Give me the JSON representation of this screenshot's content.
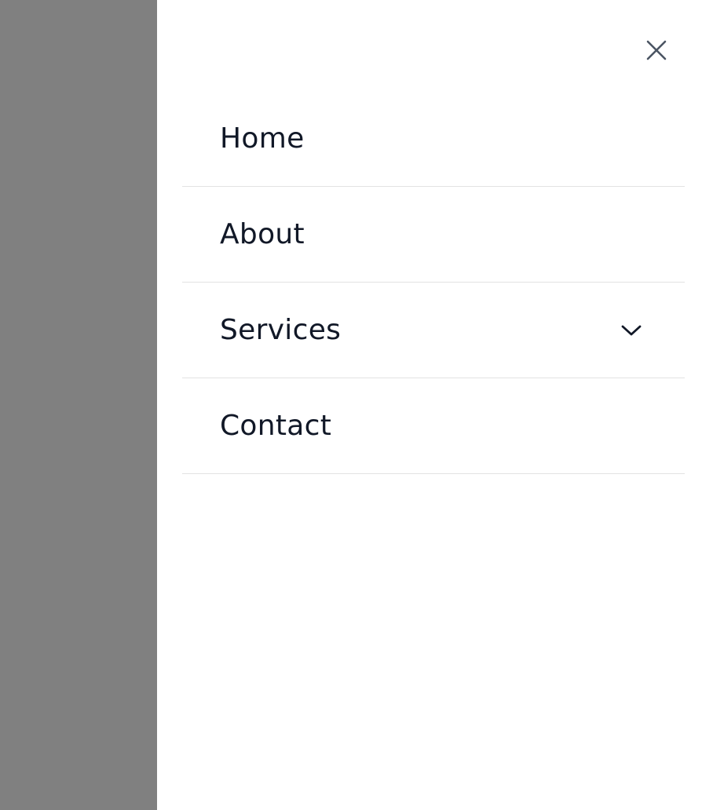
{
  "colors": {
    "overlay": "#808080",
    "drawer_bg": "#ffffff",
    "text": "#111827",
    "divider": "#e2e2e2",
    "icon": "#4b5563"
  },
  "drawer": {
    "close_icon": "close-icon",
    "nav": {
      "items": [
        {
          "label": "Home"
        },
        {
          "label": "About"
        },
        {
          "label": "Services",
          "icon": "chevron-down-icon"
        },
        {
          "label": "Contact"
        }
      ]
    }
  }
}
